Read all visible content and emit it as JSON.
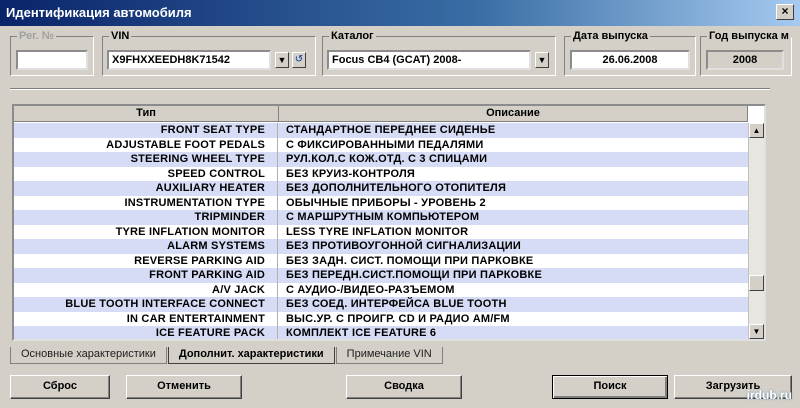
{
  "window": {
    "title": "Идентификация автомобиля",
    "close_glyph": "×"
  },
  "reg": {
    "label": "Рег. №",
    "value": ""
  },
  "vin": {
    "label": "VIN",
    "value": "X9FHXXEEDH8K71542"
  },
  "catalog": {
    "label": "Каталог",
    "value": "Focus CB4 (GCAT) 2008-"
  },
  "release_date": {
    "label": "Дата выпуска",
    "value": "26.06.2008"
  },
  "release_year": {
    "label": "Год выпуска м",
    "value": "2008"
  },
  "grid": {
    "headers": [
      "Тип",
      "Описание"
    ],
    "rows": [
      {
        "type": "FRONT SEAT TYPE",
        "desc": "СТАНДАРТНОЕ ПЕРЕДНЕЕ СИДЕНЬЕ"
      },
      {
        "type": "ADJUSTABLE FOOT PEDALS",
        "desc": "С ФИКСИРОВАННЫМИ ПЕДАЛЯМИ"
      },
      {
        "type": "STEERING WHEEL TYPE",
        "desc": "РУЛ.КОЛ.С КОЖ.ОТД. С 3 СПИЦАМИ"
      },
      {
        "type": "SPEED CONTROL",
        "desc": "БЕЗ КРУИЗ-КОНТРОЛЯ"
      },
      {
        "type": "AUXILIARY HEATER",
        "desc": "БЕЗ ДОПОЛНИТЕЛЬНОГО ОТОПИТЕЛЯ"
      },
      {
        "type": "INSTRUMENTATION TYPE",
        "desc": "ОБЫЧНЫЕ ПРИБОРЫ - УРОВЕНЬ 2"
      },
      {
        "type": "TRIPMINDER",
        "desc": "С МАРШРУТНЫМ КОМПЬЮТЕРОМ"
      },
      {
        "type": "TYRE INFLATION MONITOR",
        "desc": "LESS TYRE INFLATION MONITOR"
      },
      {
        "type": "ALARM SYSTEMS",
        "desc": "БЕЗ ПРОТИВОУГОННОЙ СИГНАЛИЗАЦИИ"
      },
      {
        "type": "REVERSE PARKING AID",
        "desc": "БЕЗ ЗАДН. СИСТ. ПОМОЩИ ПРИ ПАРКОВКЕ"
      },
      {
        "type": "FRONT PARKING AID",
        "desc": "БЕЗ ПЕРЕДН.СИСТ.ПОМОЩИ ПРИ ПАРКОВКЕ"
      },
      {
        "type": "A/V JACK",
        "desc": "С АУДИО-/ВИДЕО-РАЗЪЕМОМ"
      },
      {
        "type": "BLUE TOOTH INTERFACE CONNECT",
        "desc": "БЕЗ СОЕД. ИНТЕРФЕЙСА BLUE TOOTH"
      },
      {
        "type": "IN CAR ENTERTAINMENT",
        "desc": "ВЫС.УР. С ПРОИГР. CD И РАДИО AM/FM"
      },
      {
        "type": "ICE FEATURE PACK",
        "desc": "КОМПЛЕКТ ICE FEATURE 6"
      }
    ]
  },
  "tabs": [
    {
      "label": "Основные характеристики",
      "active": false
    },
    {
      "label": "Дополнит. характеристики",
      "active": true
    },
    {
      "label": "Примечание VIN",
      "active": false
    }
  ],
  "buttons": {
    "reset": "Сброс",
    "cancel": "Отменить",
    "summary": "Сводка",
    "search": "Поиск",
    "load": "Загрузить"
  },
  "watermark": "irdub.ru",
  "icons": {
    "dropdown": "dropdown-arrow-icon",
    "history": "history-icon",
    "scroll_up": "scroll-up-icon",
    "scroll_down": "scroll-down-icon"
  }
}
